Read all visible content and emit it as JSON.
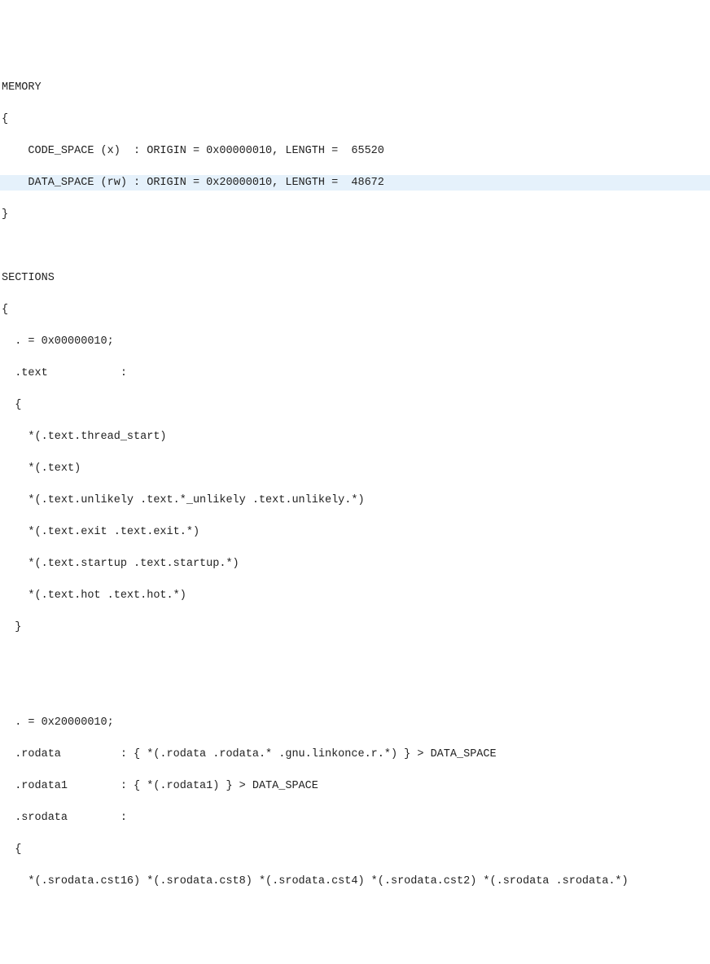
{
  "lines": [
    {
      "text": "MEMORY",
      "hl": false
    },
    {
      "text": "{",
      "hl": false
    },
    {
      "text": "    CODE_SPACE (x)  : ORIGIN = 0x00000010, LENGTH =  65520",
      "hl": false
    },
    {
      "text": "    DATA_SPACE (rw) : ORIGIN = 0x20000010, LENGTH =  48672",
      "hl": true
    },
    {
      "text": "}",
      "hl": false
    },
    {
      "text": "",
      "hl": false
    },
    {
      "text": "",
      "hl": false
    },
    {
      "text": "SECTIONS",
      "hl": false
    },
    {
      "text": "{",
      "hl": false
    },
    {
      "text": "  . = 0x00000010;",
      "hl": false
    },
    {
      "text": "  .text           :",
      "hl": false
    },
    {
      "text": "  {",
      "hl": false
    },
    {
      "text": "    *(.text.thread_start)",
      "hl": false
    },
    {
      "text": "    *(.text)",
      "hl": false
    },
    {
      "text": "    *(.text.unlikely .text.*_unlikely .text.unlikely.*)",
      "hl": false
    },
    {
      "text": "    *(.text.exit .text.exit.*)",
      "hl": false
    },
    {
      "text": "    *(.text.startup .text.startup.*)",
      "hl": false
    },
    {
      "text": "    *(.text.hot .text.hot.*)",
      "hl": false
    },
    {
      "text": "  }",
      "hl": false
    },
    {
      "text": "",
      "hl": false
    },
    {
      "text": "",
      "hl": false
    },
    {
      "text": "",
      "hl": false
    },
    {
      "text": "",
      "hl": false
    },
    {
      "text": "  . = 0x20000010;",
      "hl": false
    },
    {
      "text": "  .rodata         : { *(.rodata .rodata.* .gnu.linkonce.r.*) } > DATA_SPACE",
      "hl": false
    },
    {
      "text": "  .rodata1        : { *(.rodata1) } > DATA_SPACE",
      "hl": false
    },
    {
      "text": "  .srodata        :",
      "hl": false
    },
    {
      "text": "  {",
      "hl": false
    },
    {
      "text": "    *(.srodata.cst16) *(.srodata.cst8) *(.srodata.cst4) *(.srodata.cst2) *(.srodata .srodata.*)",
      "hl": false
    }
  ]
}
